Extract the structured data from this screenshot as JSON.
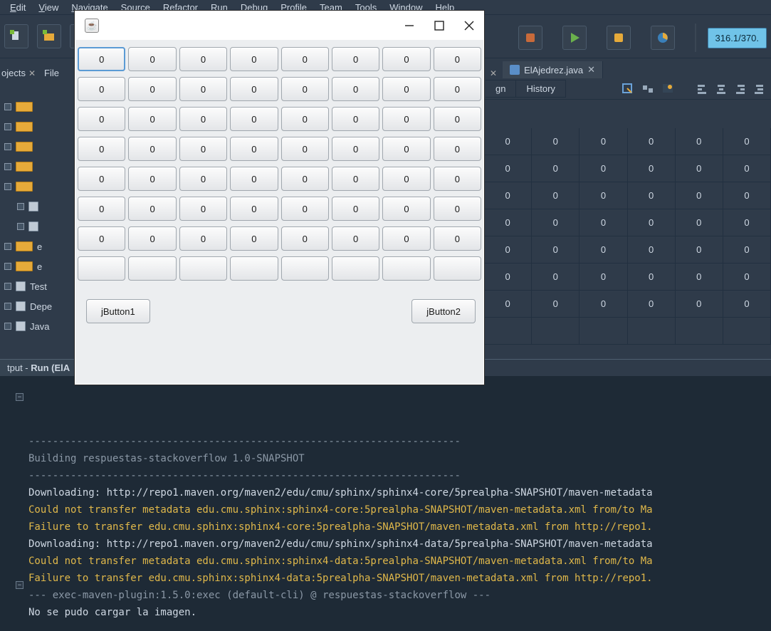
{
  "menubar": {
    "items": [
      "Edit",
      "View",
      "Navigate",
      "Source",
      "Refactor",
      "Run",
      "Debug",
      "Profile",
      "Team",
      "Tools",
      "Window",
      "Help"
    ]
  },
  "toolbar_status": "316.1/370.",
  "tabs": {
    "left_label": "ojects",
    "file_left": "File",
    "active": "ElAjedrez.java"
  },
  "subtoolbar": {
    "design": "gn",
    "history": "History"
  },
  "tree": {
    "rows": [
      {
        "cls": "",
        "icon": "pkg",
        "label": ""
      },
      {
        "cls": "",
        "icon": "pkg",
        "label": ""
      },
      {
        "cls": "",
        "icon": "pkg",
        "label": ""
      },
      {
        "cls": "",
        "icon": "pkg",
        "label": ""
      },
      {
        "cls": "",
        "icon": "pkg",
        "label": ""
      },
      {
        "cls": "indent1",
        "icon": "file",
        "label": ""
      },
      {
        "cls": "indent1",
        "icon": "file",
        "label": ""
      },
      {
        "cls": "",
        "icon": "pkg",
        "label": "e"
      },
      {
        "cls": "",
        "icon": "pkg",
        "label": "e"
      },
      {
        "cls": "",
        "icon": "file",
        "label": "Test"
      },
      {
        "cls": "",
        "icon": "file",
        "label": "Depe"
      },
      {
        "cls": "",
        "icon": "file",
        "label": "Java"
      }
    ]
  },
  "designer_grid": {
    "rows": 7,
    "cols": 6,
    "value": "0"
  },
  "output_header": {
    "prefix": "tput - ",
    "bold": "Run (ElA"
  },
  "output_lines": [
    {
      "cls": "gray",
      "text": "------------------------------------------------------------------------"
    },
    {
      "cls": "gray",
      "text": "Building respuestas-stackoverflow 1.0-SNAPSHOT"
    },
    {
      "cls": "gray",
      "text": "------------------------------------------------------------------------"
    },
    {
      "cls": "",
      "text": "Downloading: http://repo1.maven.org/maven2/edu/cmu/sphinx/sphinx4-core/5prealpha-SNAPSHOT/maven-metadata"
    },
    {
      "cls": "",
      "text": ""
    },
    {
      "cls": "yellow",
      "text": "Could not transfer metadata edu.cmu.sphinx:sphinx4-core:5prealpha-SNAPSHOT/maven-metadata.xml from/to Ma"
    },
    {
      "cls": "yellow",
      "text": "Failure to transfer edu.cmu.sphinx:sphinx4-core:5prealpha-SNAPSHOT/maven-metadata.xml from http://repo1."
    },
    {
      "cls": "",
      "text": "Downloading: http://repo1.maven.org/maven2/edu/cmu/sphinx/sphinx4-data/5prealpha-SNAPSHOT/maven-metadata"
    },
    {
      "cls": "",
      "text": ""
    },
    {
      "cls": "yellow",
      "text": "Could not transfer metadata edu.cmu.sphinx:sphinx4-data:5prealpha-SNAPSHOT/maven-metadata.xml from/to Ma"
    },
    {
      "cls": "yellow",
      "text": "Failure to transfer edu.cmu.sphinx:sphinx4-data:5prealpha-SNAPSHOT/maven-metadata.xml from http://repo1."
    },
    {
      "cls": "",
      "text": ""
    },
    {
      "cls": "gray",
      "text": "--- exec-maven-plugin:1.5.0:exec (default-cli) @ respuestas-stackoverflow ---"
    },
    {
      "cls": "",
      "text": "No se pudo cargar la imagen."
    }
  ],
  "dialog": {
    "grid": {
      "rows": 8,
      "cols": 8,
      "value": "0",
      "empty_last_row": true,
      "focus": [
        0,
        0
      ]
    },
    "buttons": {
      "left": "jButton1",
      "right": "jButton2"
    }
  }
}
